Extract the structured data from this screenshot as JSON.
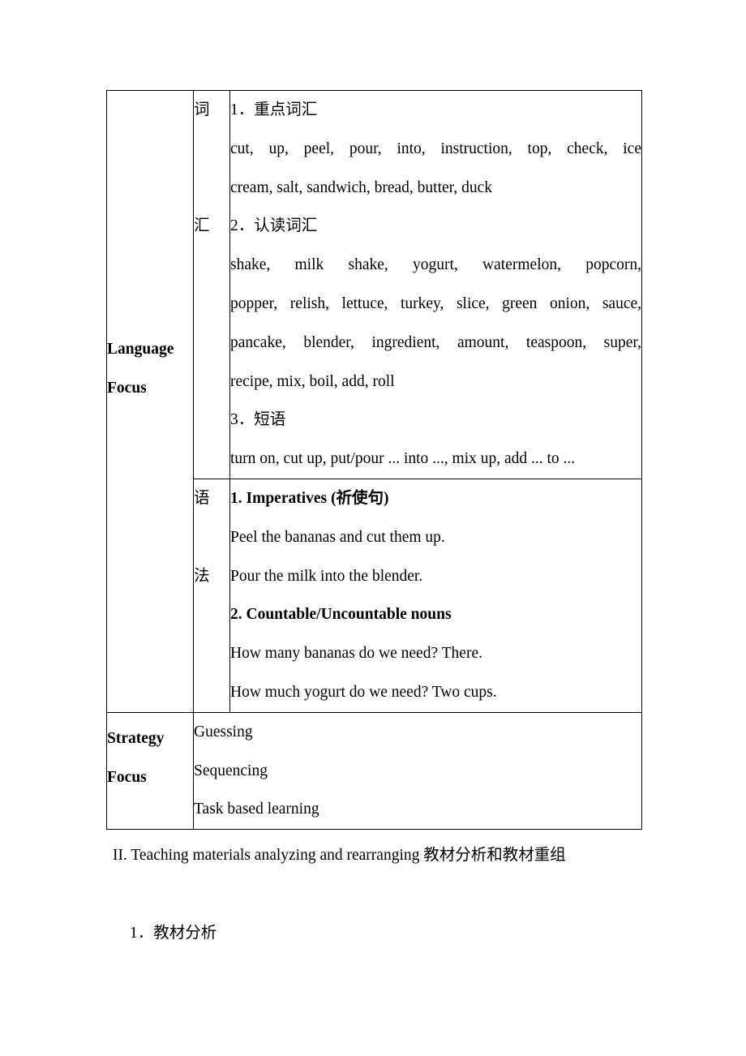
{
  "table": {
    "rows": [
      {
        "label": [
          "Language",
          "Focus"
        ],
        "sections": [
          {
            "cjk_label": [
              "词",
              "汇"
            ],
            "blocks": [
              {
                "heading": "1．重点词汇"
              },
              {
                "text_lines": [
                  "cut, up, peel, pour,    into, instruction, top, check,    ice",
                  "cream, salt, sandwich, bread, butter, duck"
                ]
              },
              {
                "heading": "2．认读词汇"
              },
              {
                "text_lines": [
                  "shake, milk shake, yogurt, watermelon, popcorn,",
                  "popper, relish, lettuce, turkey, slice, green onion, sauce,",
                  "pancake, blender, ingredient, amount, teaspoon, super,",
                  "recipe, mix, boil, add, roll"
                ]
              },
              {
                "heading": "3．短语"
              },
              {
                "text_lines": [
                  "turn on, cut up, put/pour ... into ..., mix up, add ... to ..."
                ]
              }
            ]
          },
          {
            "cjk_label": [
              "语",
              "法"
            ],
            "blocks": [
              {
                "heading_bold": "1. Imperatives (祈使句)"
              },
              {
                "text_lines": [
                  "Peel the bananas and cut them up.",
                  "Pour the milk into the blender."
                ]
              },
              {
                "heading_bold": "2. Countable/Uncountable nouns"
              },
              {
                "text_lines": [
                  "How many bananas do we need?      There.",
                  "How much yogurt do we need?          Two cups."
                ]
              }
            ]
          }
        ]
      },
      {
        "label": [
          "Strategy",
          "Focus"
        ],
        "content_lines": [
          "Guessing",
          "Sequencing",
          "Task based learning"
        ]
      }
    ]
  },
  "paragraphs": {
    "section_heading": "II. Teaching materials analyzing and rearranging  教材分析和教材重组",
    "subsection_heading": "1．教材分析"
  }
}
